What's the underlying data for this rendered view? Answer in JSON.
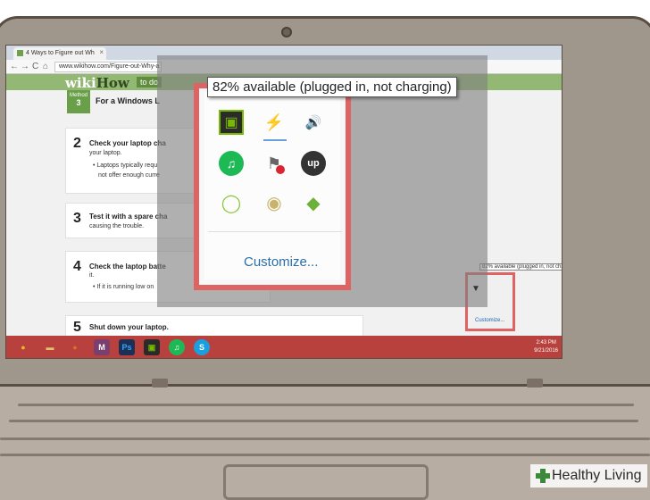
{
  "browser": {
    "tab_title": "4 Ways to Figure out Wh",
    "tab_close": "×",
    "back": "←",
    "forward": "→",
    "reload": "C",
    "home": "⌂",
    "url": "www.wikihow.com/Figure-out-Why-a"
  },
  "site": {
    "logo_wiki": "wiki",
    "logo_how": "How",
    "header_tab": "to do",
    "method_label": "Method",
    "method_number": "3",
    "method_title": "For a Windows L",
    "steps": [
      {
        "num": "2",
        "title": "Check your laptop cha",
        "line1": "your laptop.",
        "bullet1": "• Laptops typically requ",
        "bullet2": "not offer enough curre"
      },
      {
        "num": "3",
        "title": "Test it with a spare cha",
        "line1": "causing the trouble."
      },
      {
        "num": "4",
        "title": "Check the laptop batte",
        "line1": "it.",
        "bullet1": "• If it is running low on"
      },
      {
        "num": "5",
        "title": "Shut down your laptop."
      }
    ]
  },
  "taskbar": {
    "apps": [
      {
        "icon": "chrome-icon",
        "label": "●",
        "color": "#e8b52a"
      },
      {
        "icon": "folder-icon",
        "label": "▬",
        "color": "#e2c06a"
      },
      {
        "icon": "firefox-icon",
        "label": "●",
        "color": "#e06a2a"
      },
      {
        "icon": "m-app-icon",
        "label": "M",
        "color": "#7a3f6e"
      },
      {
        "icon": "photoshop-icon",
        "label": "Ps",
        "color": "#1c2f55"
      },
      {
        "icon": "nvidia-icon",
        "label": "▣",
        "color": "#2a2a2a"
      },
      {
        "icon": "spotify-icon",
        "label": "♫",
        "color": "#1db954"
      },
      {
        "icon": "skype-icon",
        "label": "S",
        "color": "#1a9fde"
      }
    ],
    "time": "2:43 PM",
    "date": "9/21/2016"
  },
  "mini_tray": {
    "tooltip": "82% available (plugged in, not charging)",
    "customize": "Customize..."
  },
  "tray_popup": {
    "tooltip": "82% available (plugged in, not charging)",
    "icons": [
      {
        "name": "nvidia-tray-icon",
        "glyph": "▣",
        "color": "#76b900"
      },
      {
        "name": "battery-plug-icon",
        "glyph": "⚡",
        "color": "#444444"
      },
      {
        "name": "volume-icon",
        "glyph": "🔊",
        "color": "#777777"
      },
      {
        "name": "spotify-tray-icon",
        "glyph": "♫",
        "color": "#1db954"
      },
      {
        "name": "action-center-flag-icon",
        "glyph": "⚑",
        "color": "#666666"
      },
      {
        "name": "upwork-icon",
        "glyph": "up",
        "color": "#333333"
      },
      {
        "name": "chat-bubble-icon",
        "glyph": "◯",
        "color": "#8cc63f"
      },
      {
        "name": "disc-drive-icon",
        "glyph": "◉",
        "color": "#c9b26a"
      },
      {
        "name": "bluestacks-icon",
        "glyph": "◆",
        "color": "#6fb03a"
      }
    ],
    "customize": "Customize..."
  },
  "overflow_arrow": "▼",
  "watermark": {
    "brand": "Healthy Living"
  }
}
